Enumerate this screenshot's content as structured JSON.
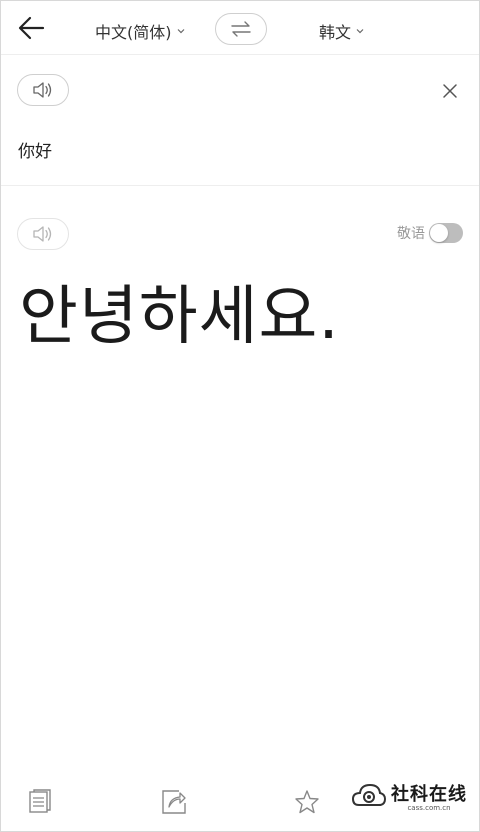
{
  "header": {
    "source_language": "中文(简体)",
    "target_language": "韩文"
  },
  "source": {
    "text": "你好"
  },
  "result": {
    "text": "안녕하세요.",
    "honorific_label": "敬语",
    "honorific_enabled": false
  },
  "watermark": {
    "title": "社科在线",
    "subtitle": "cass.com.cn"
  },
  "colors": {
    "text_primary": "#1b1b1b",
    "text_muted": "#999999",
    "border": "#cfcfcf",
    "toggle_off": "#bdbdbd"
  },
  "icons": {
    "back": "arrow-left-icon",
    "swap": "swap-arrows-icon",
    "speaker": "speaker-icon",
    "close": "close-icon",
    "copy": "copy-icon",
    "share": "share-icon",
    "star": "star-icon"
  }
}
